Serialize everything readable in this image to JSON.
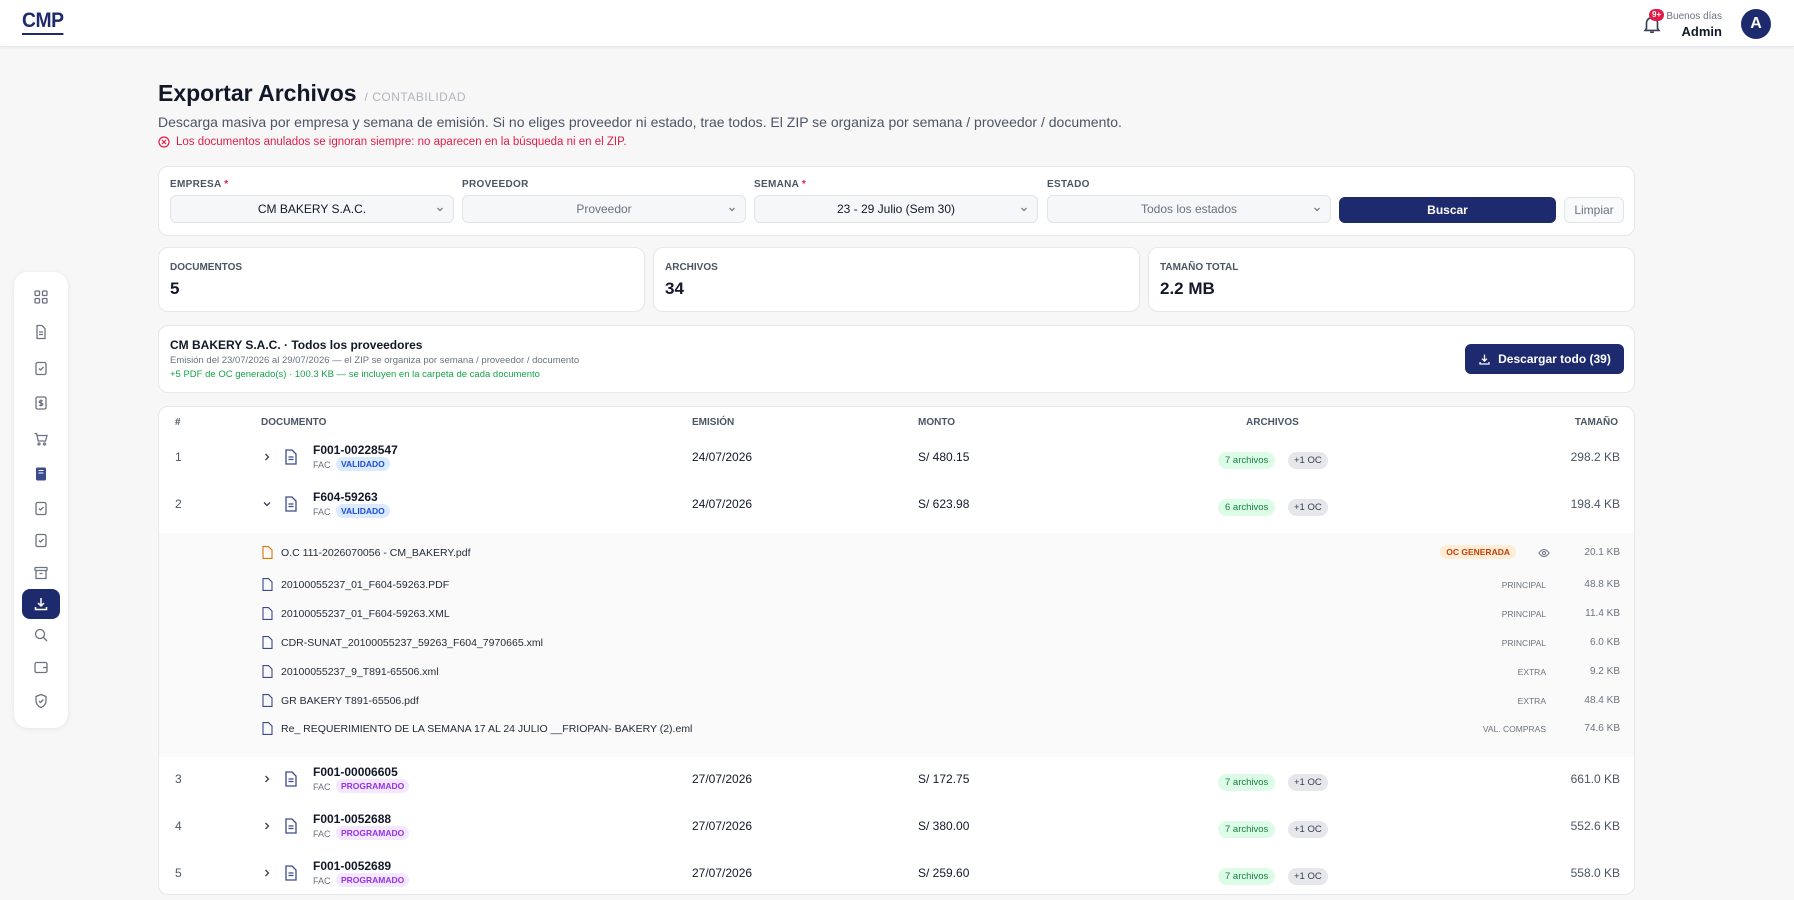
{
  "topbar": {
    "logo": "CMP",
    "notif_badge": "9+",
    "greeting": "Buenos días",
    "user": "Admin",
    "avatar_initial": "A"
  },
  "sidebar": {
    "items": [
      "dashboard",
      "documents",
      "clipboard-check",
      "money",
      "cart",
      "book",
      "clipboard-check-2",
      "clipboard-check-3",
      "archive",
      "export-download",
      "search",
      "wallet",
      "shield"
    ],
    "active": "export-download"
  },
  "page": {
    "title": "Exportar Archivos",
    "breadcrumb": "/ CONTABILIDAD",
    "description": "Descarga masiva por empresa y semana de emisión. Si no eliges proveedor ni estado, trae todos. El ZIP se organiza por semana / proveedor / documento.",
    "warning": "Los documentos anulados se ignoran siempre: no aparecen en la búsqueda ni en el ZIP."
  },
  "filters": {
    "empresa_label": "EMPRESA",
    "empresa_value": "CM BAKERY S.A.C.",
    "proveedor_label": "PROVEEDOR",
    "proveedor_placeholder": "Proveedor",
    "semana_label": "SEMANA",
    "semana_value": "23 - 29 Julio (Sem 30)",
    "estado_label": "ESTADO",
    "estado_value": "Todos los estados",
    "buscar": "Buscar",
    "limpiar": "Limpiar",
    "required_mark": "*"
  },
  "stats": [
    {
      "label": "DOCUMENTOS",
      "value": "5"
    },
    {
      "label": "ARCHIVOS",
      "value": "34"
    },
    {
      "label": "TAMAÑO TOTAL",
      "value": "2.2 MB"
    }
  ],
  "summary": {
    "title": "CM BAKERY S.A.C. · Todos los proveedores",
    "subtitle": "Emisión del 23/07/2026 al 29/07/2026 — el ZIP se organiza por semana / proveedor / documento",
    "note": "+5 PDF de OC generado(s) · 100.3 KB — se incluyen en la carpeta de cada documento",
    "download_button": "Descargar todo (39)"
  },
  "table": {
    "headers": {
      "num": "#",
      "documento": "DOCUMENTO",
      "emision": "EMISIÓN",
      "monto": "MONTO",
      "archivos": "ARCHIVOS",
      "tamano": "TAMAÑO"
    },
    "rows": [
      {
        "num": "1",
        "doc": "F001-00228547",
        "type": "FAC",
        "status": "VALIDADO",
        "emision": "24/07/2026",
        "monto": "S/ 480.15",
        "archivos": "7 archivos",
        "oc": "+1 OC",
        "size": "298.2 KB"
      },
      {
        "num": "2",
        "doc": "F604-59263",
        "type": "FAC",
        "status": "VALIDADO",
        "emision": "24/07/2026",
        "monto": "S/ 623.98",
        "archivos": "6 archivos",
        "oc": "+1 OC",
        "size": "198.4 KB"
      },
      {
        "num": "3",
        "doc": "F001-00006605",
        "type": "FAC",
        "status": "PROGRAMADO",
        "emision": "27/07/2026",
        "monto": "S/ 172.75",
        "archivos": "7 archivos",
        "oc": "+1 OC",
        "size": "661.0 KB"
      },
      {
        "num": "4",
        "doc": "F001-0052688",
        "type": "FAC",
        "status": "PROGRAMADO",
        "emision": "27/07/2026",
        "monto": "S/ 380.00",
        "archivos": "7 archivos",
        "oc": "+1 OC",
        "size": "552.6 KB"
      },
      {
        "num": "5",
        "doc": "F001-0052689",
        "type": "FAC",
        "status": "PROGRAMADO",
        "emision": "27/07/2026",
        "monto": "S/ 259.60",
        "archivos": "7 archivos",
        "oc": "+1 OC",
        "size": "558.0 KB"
      }
    ],
    "expanded_files": [
      {
        "name": "O.C 111-2026070056 - CM_BAKERY.pdf",
        "tag": "OC GENERADA",
        "size": "20.1 KB"
      },
      {
        "name": "20100055237_01_F604-59263.PDF",
        "tag": "PRINCIPAL",
        "size": "48.8 KB"
      },
      {
        "name": "20100055237_01_F604-59263.XML",
        "tag": "PRINCIPAL",
        "size": "11.4 KB"
      },
      {
        "name": "CDR-SUNAT_20100055237_59263_F604_7970665.xml",
        "tag": "PRINCIPAL",
        "size": "6.0 KB"
      },
      {
        "name": "20100055237_9_T891-65506.xml",
        "tag": "EXTRA",
        "size": "9.2 KB"
      },
      {
        "name": "GR BAKERY T891-65506.pdf",
        "tag": "EXTRA",
        "size": "48.4 KB"
      },
      {
        "name": "Re_ REQUERIMIENTO DE LA SEMANA 17 AL 24 JULIO __FRIOPAN- BAKERY (2).eml",
        "tag": "VAL. COMPRAS",
        "size": "74.6 KB"
      }
    ]
  },
  "colors": {
    "brand": "#1e2a6e",
    "danger": "#e11d48",
    "success": "#16a34a"
  }
}
